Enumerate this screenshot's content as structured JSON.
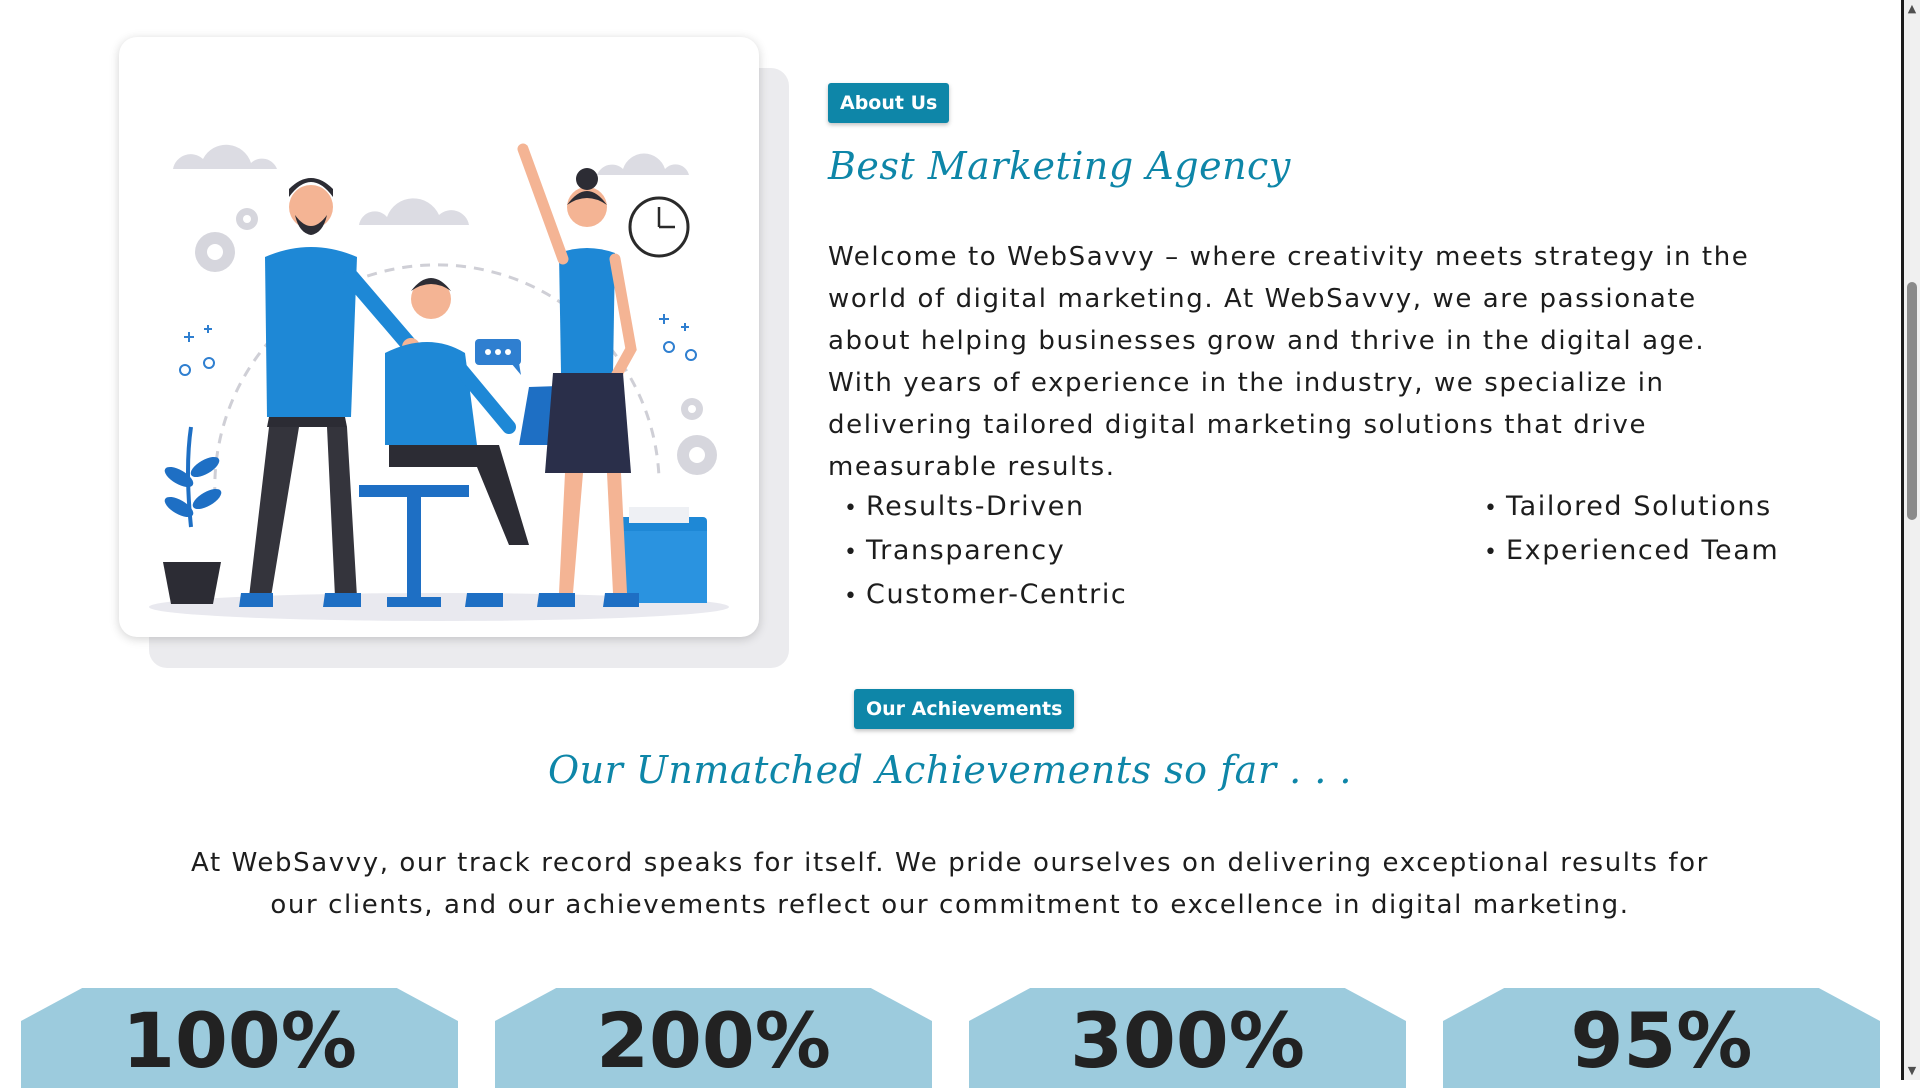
{
  "about": {
    "badge": "About Us",
    "heading": "Best Marketing Agency",
    "paragraph": "Welcome to WebSavvy – where creativity meets strategy in the world of digital marketing. At WebSavvy, we are passionate about helping businesses grow and thrive in the digital age. With years of experience in the industry, we specialize in delivering tailored digital marketing solutions that drive measurable results.",
    "features_left": [
      "Results-Driven",
      "Transparency",
      "Customer-Centric"
    ],
    "features_right": [
      "Tailored Solutions",
      "Experienced Team"
    ],
    "illustration": "team-office-illustration"
  },
  "achievements": {
    "badge": "Our Achievements",
    "heading": "Our Unmatched Achievements so far . . .",
    "paragraph": "At WebSavvy, our track record speaks for itself. We pride ourselves on delivering exceptional results for our clients, and our achievements reflect our commitment to excellence in digital marketing.",
    "stats": [
      "100%",
      "200%",
      "300%",
      "95%"
    ]
  },
  "colors": {
    "accent": "#0e86a8",
    "stat_bg": "#9ccbdd",
    "illustration_blue": "#1e88d6"
  },
  "scrollbar": {
    "up_icon": "scroll-up-arrow-icon",
    "down_icon": "scroll-down-arrow-icon"
  }
}
